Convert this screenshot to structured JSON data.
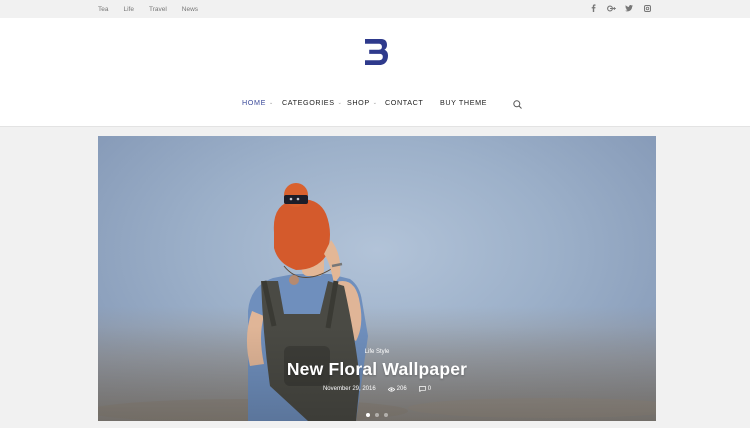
{
  "topbar": {
    "links": [
      "Tea",
      "Life",
      "Travel",
      "News"
    ],
    "social_icons": [
      "facebook-icon",
      "google-plus-icon",
      "twitter-icon",
      "instagram-icon"
    ]
  },
  "brand": {
    "logo_letter": "B",
    "color": "#2e3a8c"
  },
  "nav": {
    "items": [
      {
        "label": "HOME",
        "active": true
      },
      {
        "label": "CATEGORIES"
      },
      {
        "label": "SHOP"
      },
      {
        "label": "CONTACT"
      },
      {
        "label": "BUY THEME"
      }
    ],
    "active_color": "#3b4a9a"
  },
  "slider": {
    "category": "Life Style",
    "title": "New Floral Wallpaper",
    "date": "November 29, 2016",
    "views": "206",
    "comments": "0",
    "active_slide": 1,
    "slide_count": 3
  }
}
